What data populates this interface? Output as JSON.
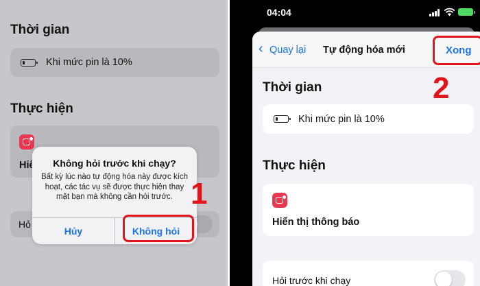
{
  "left_panel": {
    "section_time": "Thời gian",
    "battery_condition": "Khi mức pin là 10%",
    "section_do": "Thực hiện",
    "action_partial": "Hiể",
    "ask_partial": "Hỏ",
    "dialog": {
      "title": "Không hỏi trước khi chạy?",
      "message": "Bất kỳ lúc nào tự động hóa này được kích hoạt, các tác vụ sẽ được thực hiện thay mặt bạn mà không cần hỏi trước.",
      "cancel": "Hủy",
      "confirm": "Không hỏi"
    },
    "step_label": "1"
  },
  "right_panel": {
    "status_time": "04:04",
    "nav": {
      "back": "Quay lại",
      "title": "Tự động hóa mới",
      "done": "Xong"
    },
    "step_label": "2",
    "section_time": "Thời gian",
    "battery_condition": "Khi mức pin là 10%",
    "section_do": "Thực hiện",
    "action_label": "Hiển thị thông báo",
    "ask_before_run": "Hỏi trước khi chạy"
  },
  "colors": {
    "accent_blue": "#1a73e8",
    "highlight_red": "#e1141c",
    "app_icon_red": "#e8384f",
    "battery_green": "#4cd964"
  },
  "icons": [
    "battery-icon",
    "notification-app-icon",
    "back-chevron-icon",
    "signal-icon",
    "wifi-icon",
    "battery-status-icon"
  ]
}
